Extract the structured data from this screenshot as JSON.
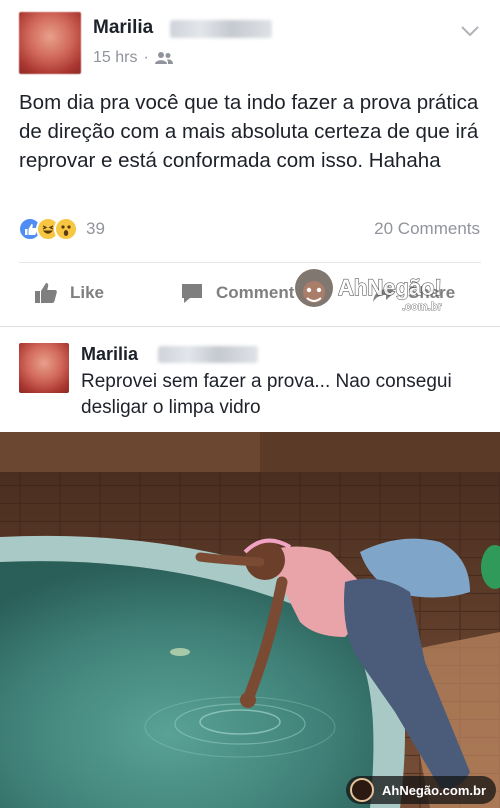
{
  "post": {
    "author": "Marilia",
    "time": "15 hrs",
    "separator": "·",
    "audience_icon": "friends-icon",
    "text": "Bom dia pra você que ta indo fazer a prova prática de direção com a mais absoluta certeza de que irá reprovar e está conformada com isso. Hahaha",
    "reaction_icons": [
      "like-icon",
      "haha-icon",
      "wow-icon"
    ],
    "reaction_count": "39",
    "comments_count": "20 Comments",
    "actions": {
      "like": "Like",
      "comment": "Comment",
      "share": "Share"
    }
  },
  "watermark": {
    "brand": "AhNegão!",
    "domain": ".com.br"
  },
  "comment": {
    "author": "Marilia",
    "text": "Reprovei sem fazer a prova... Nao consegui desligar o limpa vidro"
  },
  "photo_badge": {
    "text": "AhNegão.com.br"
  },
  "colors": {
    "text": "#1d2129",
    "muted": "#90949c",
    "like_blue": "#4f8df5",
    "reaction_yellow": "#f7c744",
    "pool_water": "#4c8e84"
  }
}
